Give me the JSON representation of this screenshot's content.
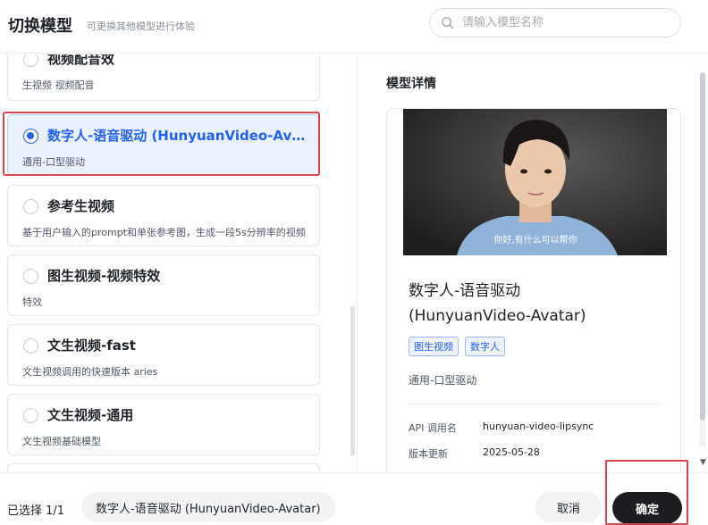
{
  "header": {
    "title": "切换模型",
    "subtitle": "可更换其他模型进行体验",
    "search_placeholder": "请输入模型名称"
  },
  "models": [
    {
      "name": "视频配音效",
      "desc": "生视频 视频配音"
    },
    {
      "name": "数字人-语音驱动 (HunyuanVideo-Avatar)",
      "desc": "通用-口型驱动",
      "selected": true
    },
    {
      "name": "参考生视频",
      "desc": "基于用户输入的prompt和单张参考图，生成一段5s分辨率的视频"
    },
    {
      "name": "图生视频-视频特效",
      "desc": "特效"
    },
    {
      "name": "文生视频-fast",
      "desc": "文生视频调用的快速版本 aries"
    },
    {
      "name": "文生视频-通用",
      "desc": "文生视频基础模型"
    }
  ],
  "detail": {
    "section_title": "模型详情",
    "preview_caption": "你好,有什么可以帮你",
    "name_line1": "数字人-语音驱动",
    "name_line2": "(HunyuanVideo-Avatar)",
    "tags": [
      "图生视频",
      "数字人"
    ],
    "description": "通用-口型驱动",
    "api_label": "API 调用名",
    "api_value": "hunyuan-video-lipsync",
    "update_label": "版本更新",
    "update_value": "2025-05-28"
  },
  "footer": {
    "selected_count": "已选择 1/1",
    "selected_model": "数字人-语音驱动 (HunyuanVideo-Avatar)",
    "cancel_label": "取消",
    "confirm_label": "确定"
  },
  "colors": {
    "accent": "#2462f5",
    "highlight": "#d8454d",
    "confirm_bg": "#1b1d21"
  }
}
